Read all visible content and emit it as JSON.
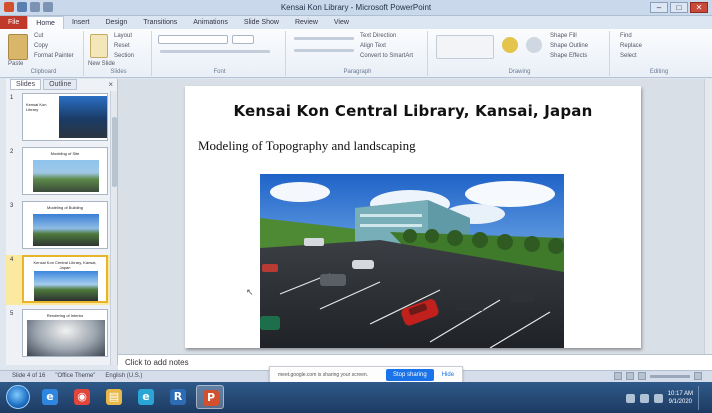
{
  "window": {
    "title": "Kensai Kon Library - Microsoft PowerPoint",
    "controls": {
      "minimize": "–",
      "maximize": "□",
      "close": "✕"
    }
  },
  "ribbon": {
    "tabs": [
      "File",
      "Home",
      "Insert",
      "Design",
      "Transitions",
      "Animations",
      "Slide Show",
      "Review",
      "View"
    ],
    "active_tab_index": 1,
    "groups": {
      "clipboard": {
        "label": "Clipboard",
        "paste": "Paste",
        "cut": "Cut",
        "copy": "Copy",
        "format_painter": "Format Painter"
      },
      "slides": {
        "label": "Slides",
        "new_slide": "New Slide",
        "layout": "Layout",
        "reset": "Reset",
        "section": "Section"
      },
      "font": {
        "label": "Font"
      },
      "paragraph": {
        "label": "Paragraph",
        "text_direction": "Text Direction",
        "align_text": "Align Text",
        "convert": "Convert to SmartArt"
      },
      "drawing": {
        "label": "Drawing",
        "shape_fill": "Shape Fill",
        "shape_outline": "Shape Outline",
        "shape_effects": "Shape Effects"
      },
      "editing": {
        "label": "Editing",
        "find": "Find",
        "replace": "Replace",
        "select": "Select"
      }
    }
  },
  "left_pane": {
    "tabs": [
      "Slides",
      "Outline"
    ],
    "active_tab_index": 0,
    "close_glyph": "×",
    "thumbnails": [
      {
        "num": "1",
        "title": "Kensai Kon Library"
      },
      {
        "num": "2",
        "title": "Modeling of Site"
      },
      {
        "num": "3",
        "title": "Modeling of Building"
      },
      {
        "num": "4",
        "title": "Kensai Kon Central Library, Kansai, Japan"
      },
      {
        "num": "5",
        "title": "Rendering of Interior"
      }
    ],
    "selected_index": 3
  },
  "slide": {
    "title": "Kensai Kon Central Library, Kansai, Japan",
    "subtitle": "Modeling of Topography and landscaping"
  },
  "notes": {
    "placeholder": "Click to add notes"
  },
  "status_bar": {
    "slide_indicator": "Slide 4 of 16",
    "theme": "\"Office Theme\"",
    "language": "English (U.S.)"
  },
  "share_notification": {
    "text": "meet.google.com is sharing your screen.",
    "stop_label": "Stop sharing",
    "hide_label": "Hide"
  },
  "taskbar": {
    "apps": [
      {
        "name": "Internet Explorer",
        "icon": "ie-icon",
        "color": "#2e86de",
        "glyph": "e"
      },
      {
        "name": "Chrome",
        "icon": "chrome-icon",
        "color": "#e1453c",
        "glyph": "◉"
      },
      {
        "name": "File Explorer",
        "icon": "folder-icon",
        "color": "#e8b84a",
        "glyph": "▤"
      },
      {
        "name": "Microsoft Edge",
        "icon": "edge-icon",
        "color": "#2aa6d6",
        "glyph": "e"
      },
      {
        "name": "Revit",
        "icon": "revit-icon",
        "color": "#2d6cb5",
        "glyph": "R"
      },
      {
        "name": "PowerPoint",
        "icon": "powerpoint-icon",
        "color": "#d2502d",
        "glyph": "P"
      }
    ],
    "active_app_index": 5,
    "clock": {
      "time": "10:17 AM",
      "date": "9/1/2020"
    }
  },
  "colors": {
    "file_tab": "#c0392b",
    "selected_thumb": "#e8b42a",
    "share_button": "#1a73e8"
  }
}
